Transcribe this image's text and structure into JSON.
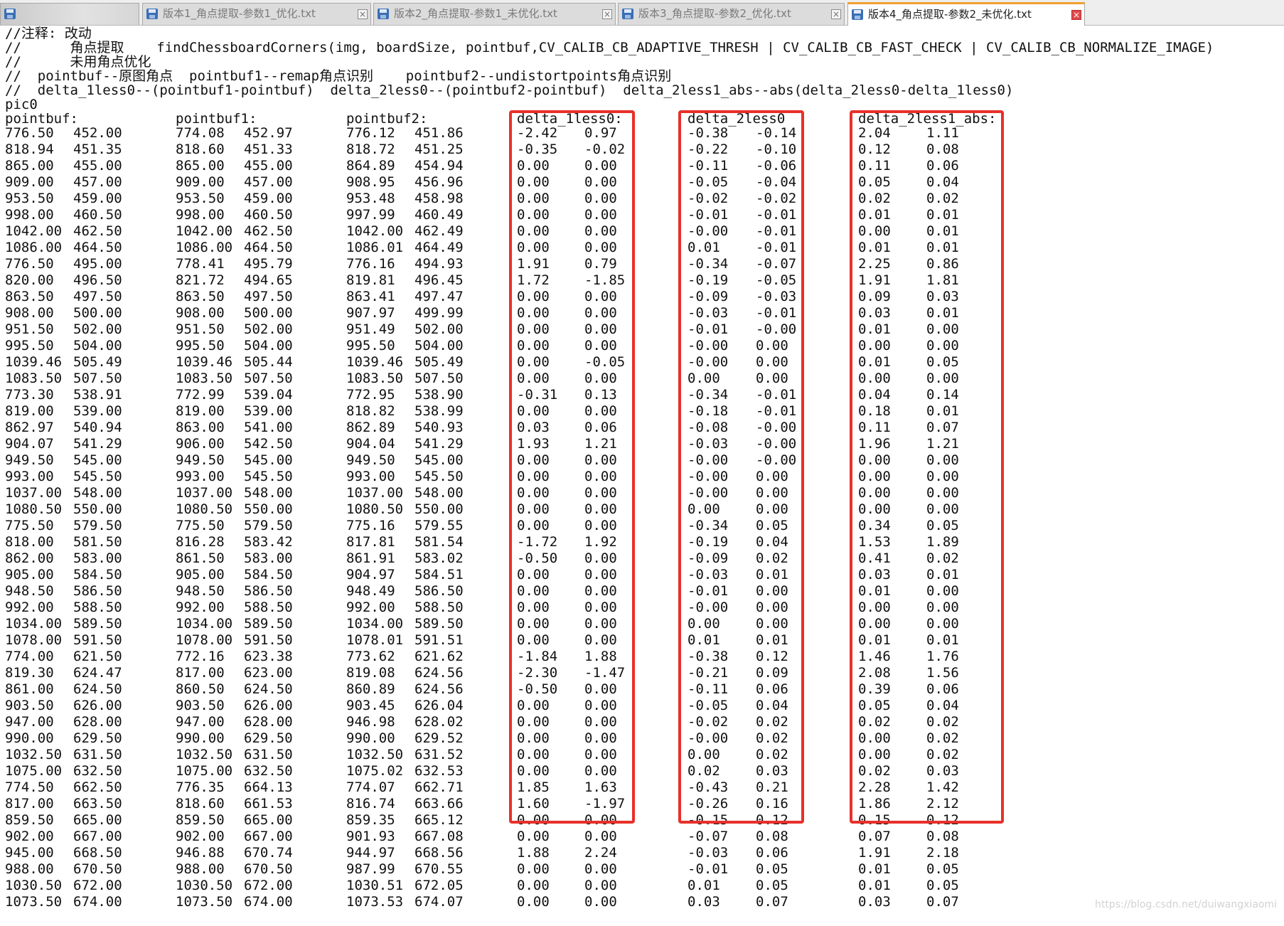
{
  "tabs": [
    {
      "label": "...",
      "active": false,
      "blurred": true,
      "close": "×"
    },
    {
      "label": "版本1_角点提取-参数1_优化.txt",
      "active": false,
      "blurred": false,
      "close": "×"
    },
    {
      "label": "版本2_角点提取-参数1_未优化.txt",
      "active": false,
      "blurred": false,
      "close": "×"
    },
    {
      "label": "版本3_角点提取-参数2_优化.txt",
      "active": false,
      "blurred": false,
      "close": "×"
    },
    {
      "label": "版本4_角点提取-参数2_未优化.txt",
      "active": true,
      "blurred": false,
      "close": "×"
    }
  ],
  "header_lines": [
    "//注释: 改动",
    "//      角点提取    findChessboardCorners(img, boardSize, pointbuf,CV_CALIB_CB_ADAPTIVE_THRESH | CV_CALIB_CB_FAST_CHECK | CV_CALIB_CB_NORMALIZE_IMAGE)",
    "//      未用角点优化",
    "//  pointbuf--原图角点  pointbuf1--remap角点识别    pointbuf2--undistortpoints角点识别",
    "//  delta_1less0--(pointbuf1-pointbuf)  delta_2less0--(pointbuf2-pointbuf)  delta_2less1_abs--abs(delta_2less0-delta_1less0)",
    "pic0"
  ],
  "column_headers": [
    "pointbuf:",
    "pointbuf1:",
    "pointbuf2:",
    "delta_1less0:",
    "delta_2less0",
    "delta_2less1_abs:"
  ],
  "rows": [
    [
      "776.50",
      "452.00",
      "774.08",
      "452.97",
      "776.12",
      "451.86",
      "-2.42",
      "0.97",
      "-0.38",
      "-0.14",
      "2.04",
      "1.11"
    ],
    [
      "818.94",
      "451.35",
      "818.60",
      "451.33",
      "818.72",
      "451.25",
      "-0.35",
      "-0.02",
      "-0.22",
      "-0.10",
      "0.12",
      "0.08"
    ],
    [
      "865.00",
      "455.00",
      "865.00",
      "455.00",
      "864.89",
      "454.94",
      "0.00",
      "0.00",
      "-0.11",
      "-0.06",
      "0.11",
      "0.06"
    ],
    [
      "909.00",
      "457.00",
      "909.00",
      "457.00",
      "908.95",
      "456.96",
      "0.00",
      "0.00",
      "-0.05",
      "-0.04",
      "0.05",
      "0.04"
    ],
    [
      "953.50",
      "459.00",
      "953.50",
      "459.00",
      "953.48",
      "458.98",
      "0.00",
      "0.00",
      "-0.02",
      "-0.02",
      "0.02",
      "0.02"
    ],
    [
      "998.00",
      "460.50",
      "998.00",
      "460.50",
      "997.99",
      "460.49",
      "0.00",
      "0.00",
      "-0.01",
      "-0.01",
      "0.01",
      "0.01"
    ],
    [
      "1042.00",
      "462.50",
      "1042.00",
      "462.50",
      "1042.00",
      "462.49",
      "0.00",
      "0.00",
      "-0.00",
      "-0.01",
      "0.00",
      "0.01"
    ],
    [
      "1086.00",
      "464.50",
      "1086.00",
      "464.50",
      "1086.01",
      "464.49",
      "0.00",
      "0.00",
      "0.01",
      "-0.01",
      "0.01",
      "0.01"
    ],
    [
      "776.50",
      "495.00",
      "778.41",
      "495.79",
      "776.16",
      "494.93",
      "1.91",
      "0.79",
      "-0.34",
      "-0.07",
      "2.25",
      "0.86"
    ],
    [
      "820.00",
      "496.50",
      "821.72",
      "494.65",
      "819.81",
      "496.45",
      "1.72",
      "-1.85",
      "-0.19",
      "-0.05",
      "1.91",
      "1.81"
    ],
    [
      "863.50",
      "497.50",
      "863.50",
      "497.50",
      "863.41",
      "497.47",
      "0.00",
      "0.00",
      "-0.09",
      "-0.03",
      "0.09",
      "0.03"
    ],
    [
      "908.00",
      "500.00",
      "908.00",
      "500.00",
      "907.97",
      "499.99",
      "0.00",
      "0.00",
      "-0.03",
      "-0.01",
      "0.03",
      "0.01"
    ],
    [
      "951.50",
      "502.00",
      "951.50",
      "502.00",
      "951.49",
      "502.00",
      "0.00",
      "0.00",
      "-0.01",
      "-0.00",
      "0.01",
      "0.00"
    ],
    [
      "995.50",
      "504.00",
      "995.50",
      "504.00",
      "995.50",
      "504.00",
      "0.00",
      "0.00",
      "-0.00",
      "0.00",
      "0.00",
      "0.00"
    ],
    [
      "1039.46",
      "505.49",
      "1039.46",
      "505.44",
      "1039.46",
      "505.49",
      "0.00",
      "-0.05",
      "-0.00",
      "0.00",
      "0.01",
      "0.05"
    ],
    [
      "1083.50",
      "507.50",
      "1083.50",
      "507.50",
      "1083.50",
      "507.50",
      "0.00",
      "0.00",
      "0.00",
      "0.00",
      "0.00",
      "0.00"
    ],
    [
      "773.30",
      "538.91",
      "772.99",
      "539.04",
      "772.95",
      "538.90",
      "-0.31",
      "0.13",
      "-0.34",
      "-0.01",
      "0.04",
      "0.14"
    ],
    [
      "819.00",
      "539.00",
      "819.00",
      "539.00",
      "818.82",
      "538.99",
      "0.00",
      "0.00",
      "-0.18",
      "-0.01",
      "0.18",
      "0.01"
    ],
    [
      "862.97",
      "540.94",
      "863.00",
      "541.00",
      "862.89",
      "540.93",
      "0.03",
      "0.06",
      "-0.08",
      "-0.00",
      "0.11",
      "0.07"
    ],
    [
      "904.07",
      "541.29",
      "906.00",
      "542.50",
      "904.04",
      "541.29",
      "1.93",
      "1.21",
      "-0.03",
      "-0.00",
      "1.96",
      "1.21"
    ],
    [
      "949.50",
      "545.00",
      "949.50",
      "545.00",
      "949.50",
      "545.00",
      "0.00",
      "0.00",
      "-0.00",
      "-0.00",
      "0.00",
      "0.00"
    ],
    [
      "993.00",
      "545.50",
      "993.00",
      "545.50",
      "993.00",
      "545.50",
      "0.00",
      "0.00",
      "-0.00",
      "0.00",
      "0.00",
      "0.00"
    ],
    [
      "1037.00",
      "548.00",
      "1037.00",
      "548.00",
      "1037.00",
      "548.00",
      "0.00",
      "0.00",
      "-0.00",
      "0.00",
      "0.00",
      "0.00"
    ],
    [
      "1080.50",
      "550.00",
      "1080.50",
      "550.00",
      "1080.50",
      "550.00",
      "0.00",
      "0.00",
      "0.00",
      "0.00",
      "0.00",
      "0.00"
    ],
    [
      "775.50",
      "579.50",
      "775.50",
      "579.50",
      "775.16",
      "579.55",
      "0.00",
      "0.00",
      "-0.34",
      "0.05",
      "0.34",
      "0.05"
    ],
    [
      "818.00",
      "581.50",
      "816.28",
      "583.42",
      "817.81",
      "581.54",
      "-1.72",
      "1.92",
      "-0.19",
      "0.04",
      "1.53",
      "1.89"
    ],
    [
      "862.00",
      "583.00",
      "861.50",
      "583.00",
      "861.91",
      "583.02",
      "-0.50",
      "0.00",
      "-0.09",
      "0.02",
      "0.41",
      "0.02"
    ],
    [
      "905.00",
      "584.50",
      "905.00",
      "584.50",
      "904.97",
      "584.51",
      "0.00",
      "0.00",
      "-0.03",
      "0.01",
      "0.03",
      "0.01"
    ],
    [
      "948.50",
      "586.50",
      "948.50",
      "586.50",
      "948.49",
      "586.50",
      "0.00",
      "0.00",
      "-0.01",
      "0.00",
      "0.01",
      "0.00"
    ],
    [
      "992.00",
      "588.50",
      "992.00",
      "588.50",
      "992.00",
      "588.50",
      "0.00",
      "0.00",
      "-0.00",
      "0.00",
      "0.00",
      "0.00"
    ],
    [
      "1034.00",
      "589.50",
      "1034.00",
      "589.50",
      "1034.00",
      "589.50",
      "0.00",
      "0.00",
      "0.00",
      "0.00",
      "0.00",
      "0.00"
    ],
    [
      "1078.00",
      "591.50",
      "1078.00",
      "591.50",
      "1078.01",
      "591.51",
      "0.00",
      "0.00",
      "0.01",
      "0.01",
      "0.01",
      "0.01"
    ],
    [
      "774.00",
      "621.50",
      "772.16",
      "623.38",
      "773.62",
      "621.62",
      "-1.84",
      "1.88",
      "-0.38",
      "0.12",
      "1.46",
      "1.76"
    ],
    [
      "819.30",
      "624.47",
      "817.00",
      "623.00",
      "819.08",
      "624.56",
      "-2.30",
      "-1.47",
      "-0.21",
      "0.09",
      "2.08",
      "1.56"
    ],
    [
      "861.00",
      "624.50",
      "860.50",
      "624.50",
      "860.89",
      "624.56",
      "-0.50",
      "0.00",
      "-0.11",
      "0.06",
      "0.39",
      "0.06"
    ],
    [
      "903.50",
      "626.00",
      "903.50",
      "626.00",
      "903.45",
      "626.04",
      "0.00",
      "0.00",
      "-0.05",
      "0.04",
      "0.05",
      "0.04"
    ],
    [
      "947.00",
      "628.00",
      "947.00",
      "628.00",
      "946.98",
      "628.02",
      "0.00",
      "0.00",
      "-0.02",
      "0.02",
      "0.02",
      "0.02"
    ],
    [
      "990.00",
      "629.50",
      "990.00",
      "629.50",
      "990.00",
      "629.52",
      "0.00",
      "0.00",
      "-0.00",
      "0.02",
      "0.00",
      "0.02"
    ],
    [
      "1032.50",
      "631.50",
      "1032.50",
      "631.50",
      "1032.50",
      "631.52",
      "0.00",
      "0.00",
      "0.00",
      "0.02",
      "0.00",
      "0.02"
    ],
    [
      "1075.00",
      "632.50",
      "1075.00",
      "632.50",
      "1075.02",
      "632.53",
      "0.00",
      "0.00",
      "0.02",
      "0.03",
      "0.02",
      "0.03"
    ],
    [
      "774.50",
      "662.50",
      "776.35",
      "664.13",
      "774.07",
      "662.71",
      "1.85",
      "1.63",
      "-0.43",
      "0.21",
      "2.28",
      "1.42"
    ],
    [
      "817.00",
      "663.50",
      "818.60",
      "661.53",
      "816.74",
      "663.66",
      "1.60",
      "-1.97",
      "-0.26",
      "0.16",
      "1.86",
      "2.12"
    ],
    [
      "859.50",
      "665.00",
      "859.50",
      "665.00",
      "859.35",
      "665.12",
      "0.00",
      "0.00",
      "-0.15",
      "0.12",
      "0.15",
      "0.12"
    ],
    [
      "902.00",
      "667.00",
      "902.00",
      "667.00",
      "901.93",
      "667.08",
      "0.00",
      "0.00",
      "-0.07",
      "0.08",
      "0.07",
      "0.08"
    ],
    [
      "945.00",
      "668.50",
      "946.88",
      "670.74",
      "944.97",
      "668.56",
      "1.88",
      "2.24",
      "-0.03",
      "0.06",
      "1.91",
      "2.18"
    ],
    [
      "988.00",
      "670.50",
      "988.00",
      "670.50",
      "987.99",
      "670.55",
      "0.00",
      "0.00",
      "-0.01",
      "0.05",
      "0.01",
      "0.05"
    ],
    [
      "1030.50",
      "672.00",
      "1030.50",
      "672.00",
      "1030.51",
      "672.05",
      "0.00",
      "0.00",
      "0.01",
      "0.05",
      "0.01",
      "0.05"
    ],
    [
      "1073.50",
      "674.00",
      "1073.50",
      "674.00",
      "1073.53",
      "674.07",
      "0.00",
      "0.00",
      "0.03",
      "0.07",
      "0.03",
      "0.07"
    ]
  ],
  "watermark": "https://blog.csdn.net/duiwangxiaomi",
  "colors": {
    "highlight_box": "#e8302a",
    "active_tab_accent": "#f0a030",
    "file_icon": "#3a6fb5",
    "active_close": "#e04a4a"
  },
  "icons": {
    "tab": "file-save-icon",
    "close": "close-icon"
  }
}
